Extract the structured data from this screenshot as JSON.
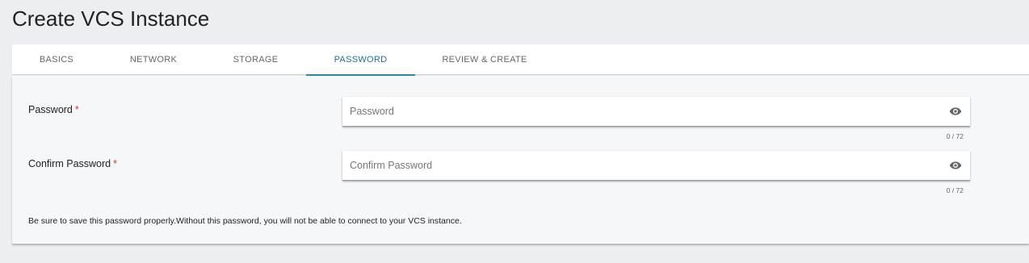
{
  "page": {
    "title": "Create VCS Instance"
  },
  "tabs": [
    {
      "label": "BASICS",
      "active": false
    },
    {
      "label": "NETWORK",
      "active": false
    },
    {
      "label": "STORAGE",
      "active": false
    },
    {
      "label": "PASSWORD",
      "active": true
    },
    {
      "label": "REVIEW & CREATE",
      "active": false
    }
  ],
  "form": {
    "password": {
      "label": "Password",
      "required_mark": "*",
      "placeholder": "Password",
      "value": "",
      "counter": "0 / 72",
      "icon": "eye-icon"
    },
    "confirm_password": {
      "label": "Confirm Password",
      "required_mark": "*",
      "placeholder": "Confirm Password",
      "value": "",
      "counter": "0 / 72",
      "icon": "eye-icon"
    },
    "notice": "Be sure to save this password properly.Without this password, you will not be able to connect to your VCS instance."
  },
  "colors": {
    "accent": "#2c8aa0",
    "active_tab_text": "#1f7389",
    "required": "#e0312f",
    "background": "#eceef1"
  }
}
